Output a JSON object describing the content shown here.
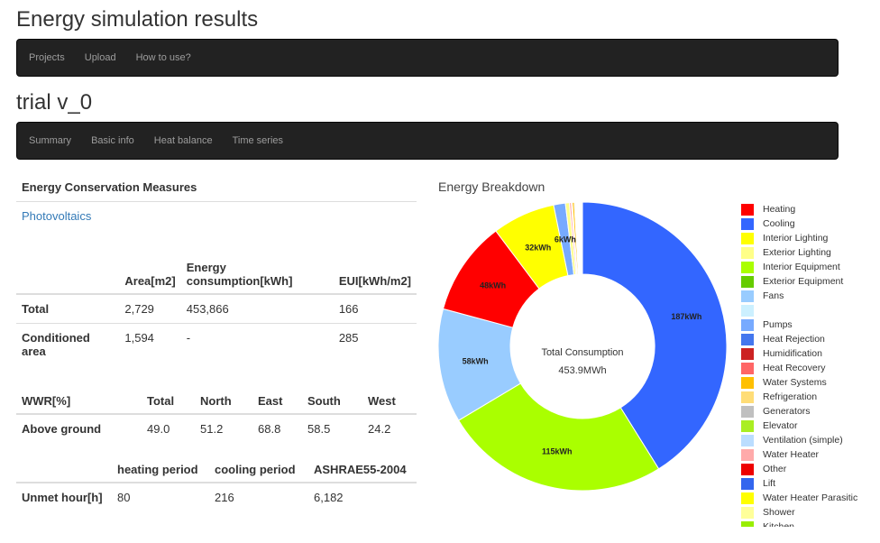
{
  "app_title": "Energy simulation results",
  "top_nav": [
    "Projects",
    "Upload",
    "How to use?"
  ],
  "project_title": "trial v_0",
  "sub_nav": [
    "Summary",
    "Basic info",
    "Heat balance",
    "Time series"
  ],
  "ecm": {
    "heading": "Energy Conservation Measures",
    "link": "Photovoltaics"
  },
  "energy_table": {
    "headers": [
      "",
      "Area[m2]",
      "Energy consumption[kWh]",
      "EUI[kWh/m2]"
    ],
    "rows": [
      [
        "Total",
        "2,729",
        "453,866",
        "166"
      ],
      [
        "Conditioned area",
        "1,594",
        "-",
        "285"
      ]
    ]
  },
  "wwr_table": {
    "headers": [
      "WWR[%]",
      "Total",
      "North",
      "East",
      "South",
      "West"
    ],
    "rows": [
      [
        "Above ground",
        "49.0",
        "51.2",
        "68.8",
        "58.5",
        "24.2"
      ]
    ]
  },
  "unmet_table": {
    "headers": [
      "",
      "heating period",
      "cooling period",
      "ASHRAE55-2004"
    ],
    "rows": [
      [
        "Unmet hour[h]",
        "80",
        "216",
        "6,182"
      ]
    ]
  },
  "chart_data": {
    "type": "pie",
    "title": "Energy Breakdown",
    "center_label": "Total Consumption",
    "center_value": "453.9MWh",
    "slices": [
      {
        "name": "Heating",
        "value": 48,
        "label": "48kWh",
        "color": "#ff0000"
      },
      {
        "name": "Cooling",
        "value": 187,
        "label": "187kWh",
        "color": "#3366ff"
      },
      {
        "name": "Interior Lighting",
        "value": 32,
        "label": "32kWh",
        "color": "#ffff00"
      },
      {
        "name": "Exterior Lighting",
        "value": 2,
        "label": "",
        "color": "#ffff88"
      },
      {
        "name": "Interior Equipment",
        "value": 115,
        "label": "115kWh",
        "color": "#aaff00"
      },
      {
        "name": "Exterior Equipment",
        "value": 0.3,
        "label": "",
        "color": "#66cc00"
      },
      {
        "name": "Fans",
        "value": 58,
        "label": "58kWh",
        "color": "#99ccff"
      },
      {
        "name": "",
        "value": 0.3,
        "label": "",
        "color": "#ccf0ff"
      },
      {
        "name": "Pumps",
        "value": 6,
        "label": "6kWh",
        "color": "#77aaff"
      },
      {
        "name": "Heat Rejection",
        "value": 0.5,
        "label": "",
        "color": "#4477ee"
      },
      {
        "name": "Humidification",
        "value": 0.3,
        "label": "",
        "color": "#cc2222"
      },
      {
        "name": "Heat Recovery",
        "value": 0.5,
        "label": "",
        "color": "#ff6666"
      },
      {
        "name": "Water Systems",
        "value": 1,
        "label": "",
        "color": "#ffc000"
      },
      {
        "name": "Refrigeration",
        "value": 0.3,
        "label": "",
        "color": "#ffdd77"
      },
      {
        "name": "Generators",
        "value": 0.3,
        "label": "",
        "color": "#c0c0c0"
      },
      {
        "name": "Elevator",
        "value": 0.3,
        "label": "",
        "color": "#aaee22"
      },
      {
        "name": "Ventilation (simple)",
        "value": 0.3,
        "label": "",
        "color": "#bbddff"
      },
      {
        "name": "Water Heater",
        "value": 1,
        "label": "",
        "color": "#ffaaaa"
      },
      {
        "name": "Other",
        "value": 0.3,
        "label": "",
        "color": "#ee0000"
      },
      {
        "name": "Lift",
        "value": 0.3,
        "label": "",
        "color": "#3366ee"
      },
      {
        "name": "Water Heater Parasitic",
        "value": 0.3,
        "label": "",
        "color": "#ffff00"
      },
      {
        "name": "Shower",
        "value": 0.3,
        "label": "",
        "color": "#ffff99"
      },
      {
        "name": "Kitchen",
        "value": 0.3,
        "label": "",
        "color": "#99ee00"
      }
    ],
    "legend_position": "right"
  }
}
